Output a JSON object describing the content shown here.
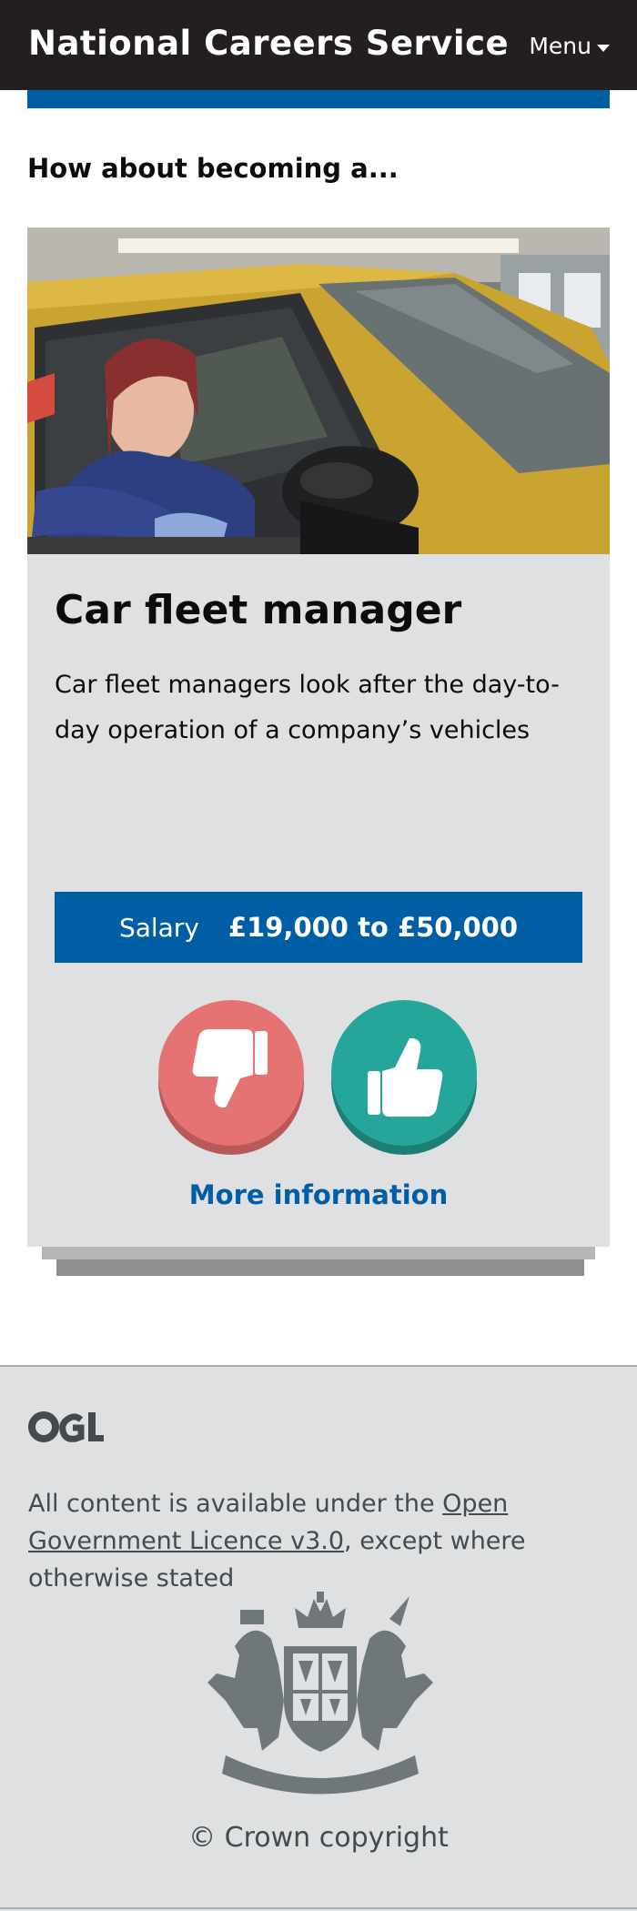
{
  "header": {
    "brand": "National Careers Service",
    "menu_label": "Menu"
  },
  "main": {
    "prompt": "How about becoming a..."
  },
  "job_card": {
    "image_alt": "Person sitting in a yellow car",
    "title": "Car fleet manager",
    "description": "Car fleet managers look after the day-to-day operation of a company’s vehicles",
    "salary_label": "Salary",
    "salary_value": "£19,000 to £50,000",
    "more_info_label": "More information",
    "dislike_icon": "thumbs-down-icon",
    "like_icon": "thumbs-up-icon",
    "colors": {
      "dislike": "#e57373",
      "like": "#26a69a",
      "salary_bg": "#005ea5"
    }
  },
  "footer": {
    "licence_prefix": "All content is available under the ",
    "licence_link": "Open Government Licence v3.0",
    "licence_suffix": ", except where otherwise stated",
    "copyright": "© Crown copyright",
    "logo_text": "OGL"
  }
}
